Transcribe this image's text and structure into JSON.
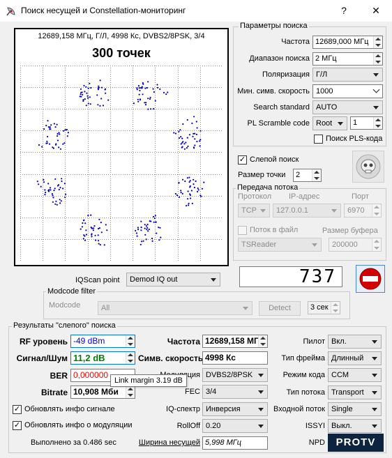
{
  "window": {
    "title": "Поиск несущей и Constellation-мониторинг",
    "help_label": "?",
    "close_label": "✕"
  },
  "constellation": {
    "header": "12689,158 МГц, Г/Л, 4998 Кс, DVBS2/8PSK, 3/4",
    "points_title": "300 точек"
  },
  "search_params": {
    "group_title": "Параметры поиска",
    "frequency_label": "Частота",
    "frequency_value": "12689,000 МГц",
    "range_label": "Диапазон поиска",
    "range_value": "2 МГц",
    "polarization_label": "Поляризация",
    "polarization_value": "Г/Л",
    "min_sr_label": "Мин. симв. скорость",
    "min_sr_value": "1000",
    "search_standard_label": "Search standard",
    "search_standard_value": "AUTO",
    "pl_scramble_label": "PL Scramble code",
    "pl_scramble_mode": "Root",
    "pl_scramble_value": "1",
    "pls_search_label": "Поиск PLS-кода"
  },
  "blind": {
    "blind_search_label": "Слепой поиск",
    "point_size_label": "Размер точки",
    "point_size_value": "2"
  },
  "stream": {
    "group_title": "Передача потока",
    "protocol_header": "Протокол",
    "ip_header": "IP-адрес",
    "port_header": "Порт",
    "protocol_value": "TCP",
    "ip_value": "127.0.0.1",
    "port_value": "6970",
    "to_file_label": "Поток в файл",
    "buffer_label": "Размер буфера",
    "reader_value": "TSReader",
    "buffer_value": "200000"
  },
  "display": {
    "counter": "737"
  },
  "iq": {
    "label": "IQScan point",
    "value": "Demod IQ out"
  },
  "modcode": {
    "group_title": "Modcode filter",
    "label": "Modcode",
    "value": "All",
    "detect_label": "Detect",
    "time_value": "3 сек"
  },
  "results": {
    "group_title": "Результаты \"слепого\" поиска",
    "rf_label": "RF уровень",
    "rf_value": "-49 dBm",
    "snr_label": "Сигнал/Шум",
    "snr_value": "11,2 dB",
    "ber_label": "BER",
    "ber_value": "0,000000",
    "bitrate_label": "Bitrate",
    "bitrate_value": "10,908 Мби",
    "tooltip": "Link margin 3.19 dB",
    "freq_label": "Частота",
    "freq_value": "12689,158 МГ",
    "sr_label": "Симв. скорость",
    "sr_value": "4998 Кс",
    "mod_label": "Модуляция",
    "mod_value": "DVBS2/8PSK",
    "fec_label": "FEC",
    "fec_value": "3/4",
    "iq_spectrum_label": "IQ-спектр",
    "iq_spectrum_value": "Инверсия",
    "rolloff_label": "RollOff",
    "rolloff_value": "0.20",
    "bandwidth_label": "Ширина несущей",
    "bandwidth_value": "5,998 МГц",
    "pilot_label": "Пилот",
    "pilot_value": "Вкл.",
    "frame_label": "Тип фрейма",
    "frame_value": "Длинный",
    "code_mode_label": "Режим кода",
    "code_mode_value": "CCM",
    "stream_type_label": "Тип потока",
    "stream_type_value": "Transport",
    "input_stream_label": "Входной поток",
    "input_stream_value": "Single",
    "issyi_label": "ISSYI",
    "issyi_value": "Выкл.",
    "npd_label": "NPD",
    "update_signal_label": "Обновлять инфо сигнале",
    "update_mod_label": "Обновлять инфо о модуляции",
    "done_label": "Выполнено за 0.486 sec"
  },
  "watermark": "PROTV",
  "colors": {
    "rf_value": "#0000e0",
    "snr_value": "#008000",
    "ber_value": "#ff0000",
    "points": "#0000cc",
    "stop_button": "#d20000"
  },
  "icons": {
    "app": "satellite-dish-icon",
    "stop": "stop-sign-icon",
    "logo": "skull-logo-icon"
  }
}
